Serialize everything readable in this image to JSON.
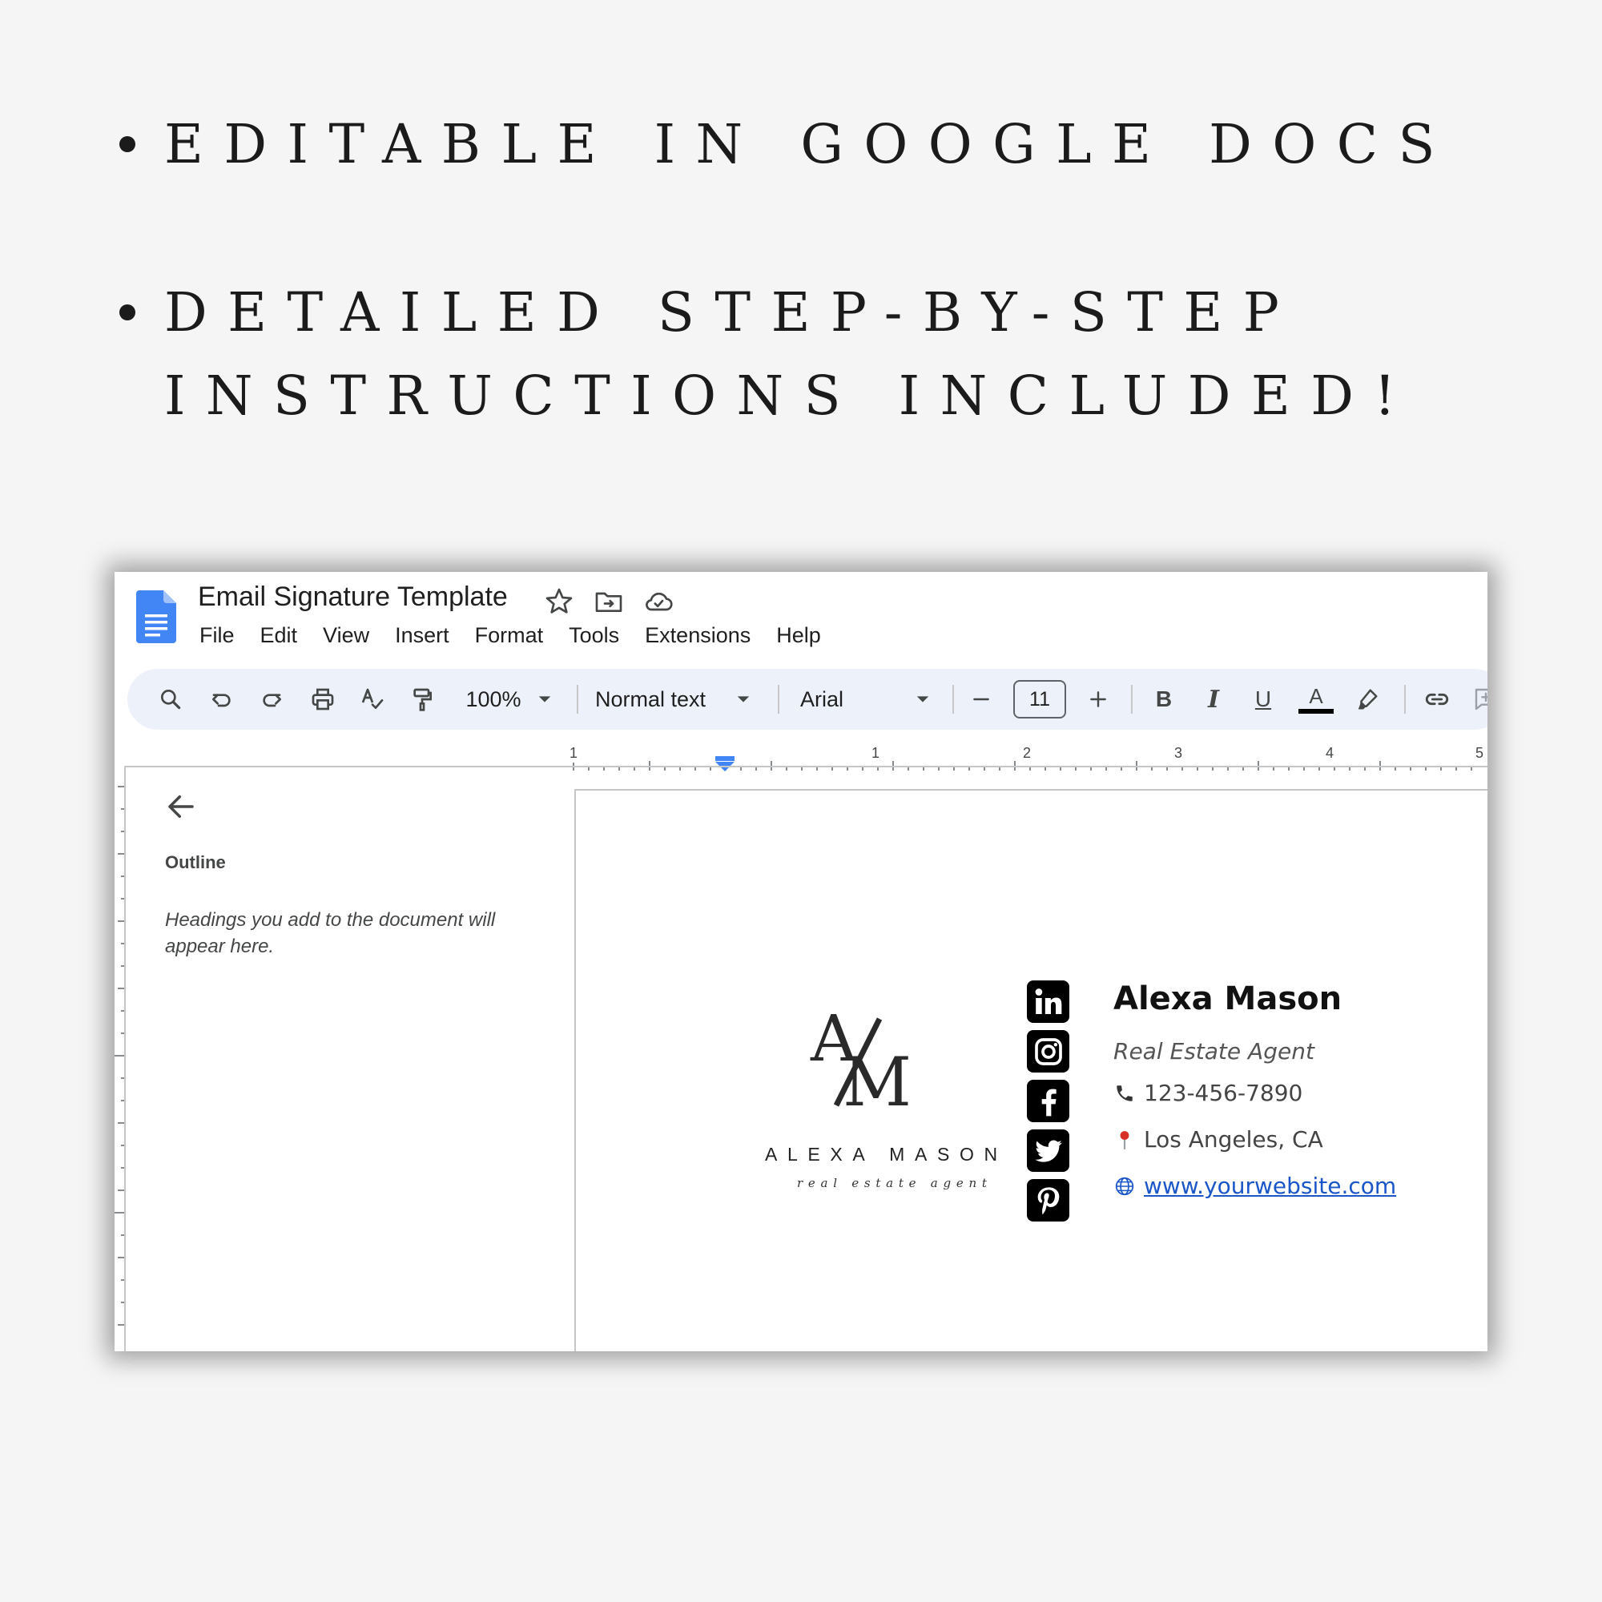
{
  "headline": {
    "line1": "EDITABLE IN GOOGLE DOCS",
    "line2a": "DETAILED STEP-BY-STEP",
    "line2b": "INSTRUCTIONS INCLUDED!"
  },
  "doc": {
    "title": "Email Signature Template",
    "menu": [
      "File",
      "Edit",
      "View",
      "Insert",
      "Format",
      "Tools",
      "Extensions",
      "Help"
    ]
  },
  "toolbar": {
    "zoom": "100%",
    "style": "Normal text",
    "font": "Arial",
    "font_size": "11",
    "bold_label": "B",
    "italic_label": "I",
    "underline_label": "U",
    "text_color_label": "A"
  },
  "ruler": {
    "labels": [
      "1",
      "1",
      "2",
      "3",
      "4",
      "5"
    ]
  },
  "sidebar": {
    "title": "Outline",
    "hint": "Headings you add to the document will appear here."
  },
  "signature": {
    "monogram": "AM",
    "logo_name": "ALEXA MASON",
    "logo_sub": "real estate agent",
    "name": "Alexa Mason",
    "title": "Real Estate Agent",
    "phone": "123-456-7890",
    "location": "Los Angeles, CA",
    "website": "www.yourwebsite.com",
    "social": [
      "linkedin-icon",
      "instagram-icon",
      "facebook-icon",
      "twitter-icon",
      "pinterest-icon"
    ]
  },
  "colors": {
    "docs_blue": "#4285f4",
    "link_blue": "#1a56c8",
    "toolbar_bg": "#edf2fa"
  }
}
